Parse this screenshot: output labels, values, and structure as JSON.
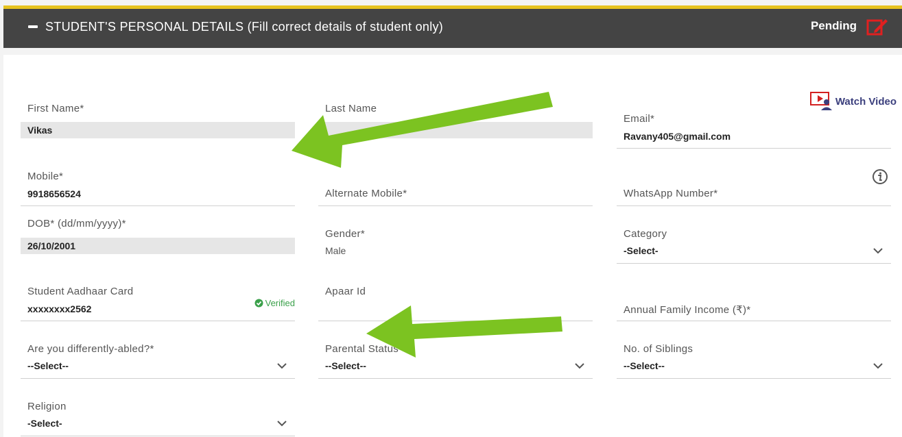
{
  "header": {
    "title": "STUDENT'S PERSONAL DETAILS (Fill correct details of student only)",
    "status": "Pending"
  },
  "watch_video": {
    "label": "Watch Video"
  },
  "fields": {
    "first_name": {
      "label": "First Name*",
      "value": "Vikas"
    },
    "last_name": {
      "label": "Last Name",
      "value": ""
    },
    "email": {
      "label": "Email*",
      "value": "Ravany405@gmail.com"
    },
    "mobile": {
      "label": "Mobile*",
      "value": "9918656524"
    },
    "alternate_mobile": {
      "label": "Alternate Mobile*",
      "value": ""
    },
    "whatsapp": {
      "label": "WhatsApp Number*",
      "value": ""
    },
    "dob": {
      "label": "DOB* (dd/mm/yyyy)*",
      "value": "26/10/2001"
    },
    "gender": {
      "label": "Gender*",
      "value": "Male"
    },
    "category": {
      "label": "Category",
      "value": "-Select-"
    },
    "aadhaar": {
      "label": "Student Aadhaar Card",
      "value": "xxxxxxxx2562",
      "badge": "Verified"
    },
    "apaar": {
      "label": "Apaar Id",
      "value": ""
    },
    "income": {
      "label": "Annual Family Income (₹)*",
      "value": ""
    },
    "differently_abled": {
      "label": "Are you differently-abled?*",
      "value": "--Select--"
    },
    "parental_status": {
      "label": "Parental Status",
      "value": "--Select--"
    },
    "siblings": {
      "label": "No. of Siblings",
      "value": "--Select--"
    },
    "religion": {
      "label": "Religion",
      "value": "-Select-"
    }
  },
  "colors": {
    "accent_bar": "#e6c21f",
    "header_bg": "#444444",
    "arrow": "#7cc321",
    "verified": "#3aa04a",
    "edit_icon": "#e02020"
  }
}
